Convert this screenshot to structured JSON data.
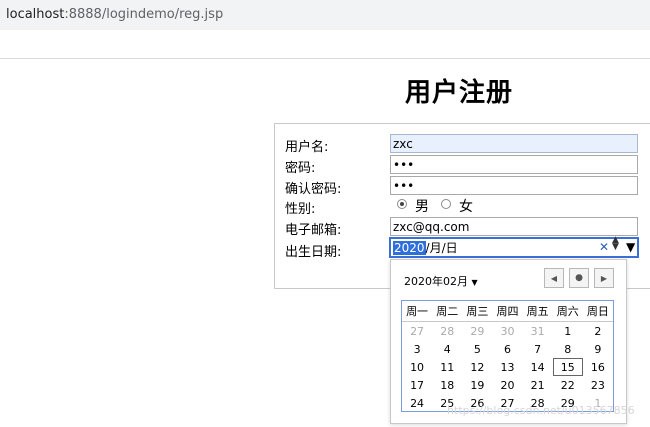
{
  "browser": {
    "url_host": "localhost",
    "url_path": ":8888/logindemo/reg.jsp"
  },
  "page": {
    "title": "用户注册"
  },
  "form": {
    "username": {
      "label": "用户名:",
      "value": "zxc"
    },
    "password": {
      "label": "密码:",
      "value": "•••"
    },
    "confirm": {
      "label": "确认密码:",
      "value": "•••"
    },
    "gender": {
      "label": "性别:",
      "options": [
        "男",
        "女"
      ],
      "selected": "男"
    },
    "email": {
      "label": "电子邮箱:",
      "value": "zxc@qq.com"
    },
    "birthday": {
      "label": "出生日期:",
      "year": "2020",
      "sep1": "/",
      "month": "月",
      "sep2": "/",
      "day": "日"
    }
  },
  "datepicker": {
    "month_label": "2020年02月",
    "weekdays": [
      "周一",
      "周二",
      "周三",
      "周四",
      "周五",
      "周六",
      "周日"
    ],
    "weeks": [
      [
        "27",
        "28",
        "29",
        "30",
        "31",
        "1",
        "2"
      ],
      [
        "3",
        "4",
        "5",
        "6",
        "7",
        "8",
        "9"
      ],
      [
        "10",
        "11",
        "12",
        "13",
        "14",
        "15",
        "16"
      ],
      [
        "17",
        "18",
        "19",
        "20",
        "21",
        "22",
        "23"
      ],
      [
        "24",
        "25",
        "26",
        "27",
        "28",
        "29",
        "1"
      ]
    ],
    "other_month_cells": [
      [
        0,
        0
      ],
      [
        0,
        1
      ],
      [
        0,
        2
      ],
      [
        0,
        3
      ],
      [
        0,
        4
      ],
      [
        4,
        6
      ]
    ],
    "today": "15"
  },
  "watermark": "https://blog.csdn.net/u013567856"
}
